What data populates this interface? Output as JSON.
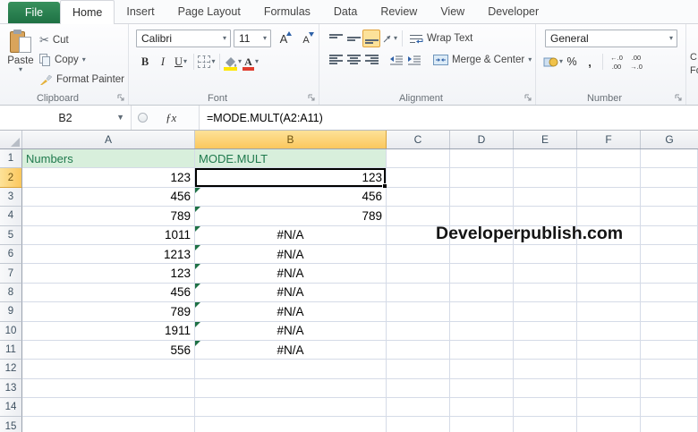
{
  "tabs": {
    "file": "File",
    "items": [
      "Home",
      "Insert",
      "Page Layout",
      "Formulas",
      "Data",
      "Review",
      "View",
      "Developer"
    ]
  },
  "icons": {
    "dropdown": "▾",
    "namebox_dropdown": "▼",
    "cut": "✂"
  },
  "ribbon": {
    "clipboard": {
      "label": "Clipboard",
      "paste": "Paste",
      "cut": "Cut",
      "copy": "Copy",
      "format_painter": "Format Painter"
    },
    "font": {
      "label": "Font",
      "family": "Calibri",
      "size": "11",
      "bold": "B",
      "italic": "I",
      "underline": "U",
      "grow": "A",
      "shrink": "A"
    },
    "alignment": {
      "label": "Alignment",
      "wrap_text": "Wrap Text",
      "merge_center": "Merge & Center"
    },
    "number": {
      "label": "Number",
      "format": "General",
      "percent": "%",
      "comma": ",",
      "inc_decimal_top": "←.0",
      "inc_decimal_bottom": ".00",
      "dec_decimal_top": ".00",
      "dec_decimal_bottom": "→.0"
    },
    "cutoff_lines": [
      "C",
      "Fo"
    ]
  },
  "formula_bar": {
    "cell_ref": "B2",
    "fx": "ƒx",
    "formula": "=MODE.MULT(A2:A11)"
  },
  "sheet": {
    "column_headers": [
      "A",
      "B",
      "C",
      "D",
      "E",
      "F",
      "G"
    ],
    "active_column": "B",
    "active_row": "2",
    "watermark": "Developerpublish.com",
    "rows": [
      {
        "n": "1",
        "A": "Numbers",
        "B": "MODE.MULT",
        "style": "header"
      },
      {
        "n": "2",
        "A": "123",
        "B": "123",
        "selected": "B"
      },
      {
        "n": "3",
        "A": "456",
        "B": "456",
        "flag": true
      },
      {
        "n": "4",
        "A": "789",
        "B": "789",
        "flag": true
      },
      {
        "n": "5",
        "A": "1011",
        "B": "#N/A",
        "flag": true
      },
      {
        "n": "6",
        "A": "1213",
        "B": "#N/A",
        "flag": true
      },
      {
        "n": "7",
        "A": "123",
        "B": "#N/A",
        "flag": true
      },
      {
        "n": "8",
        "A": "456",
        "B": "#N/A",
        "flag": true
      },
      {
        "n": "9",
        "A": "789",
        "B": "#N/A",
        "flag": true
      },
      {
        "n": "10",
        "A": "1911",
        "B": "#N/A",
        "flag": true
      },
      {
        "n": "11",
        "A": "556",
        "B": "#N/A",
        "flag": true
      },
      {
        "n": "12"
      },
      {
        "n": "13"
      },
      {
        "n": "14"
      },
      {
        "n": "15"
      }
    ]
  },
  "colors": {
    "file_tab_green": "#217346",
    "selection_gold": "#FBCE5D",
    "good_cell_bg": "#D8EFDC",
    "good_cell_text": "#1F7A4D",
    "error_indicator_green": "#1E7145",
    "gridline": "#D5DBE7",
    "selection_border": "#000000"
  }
}
